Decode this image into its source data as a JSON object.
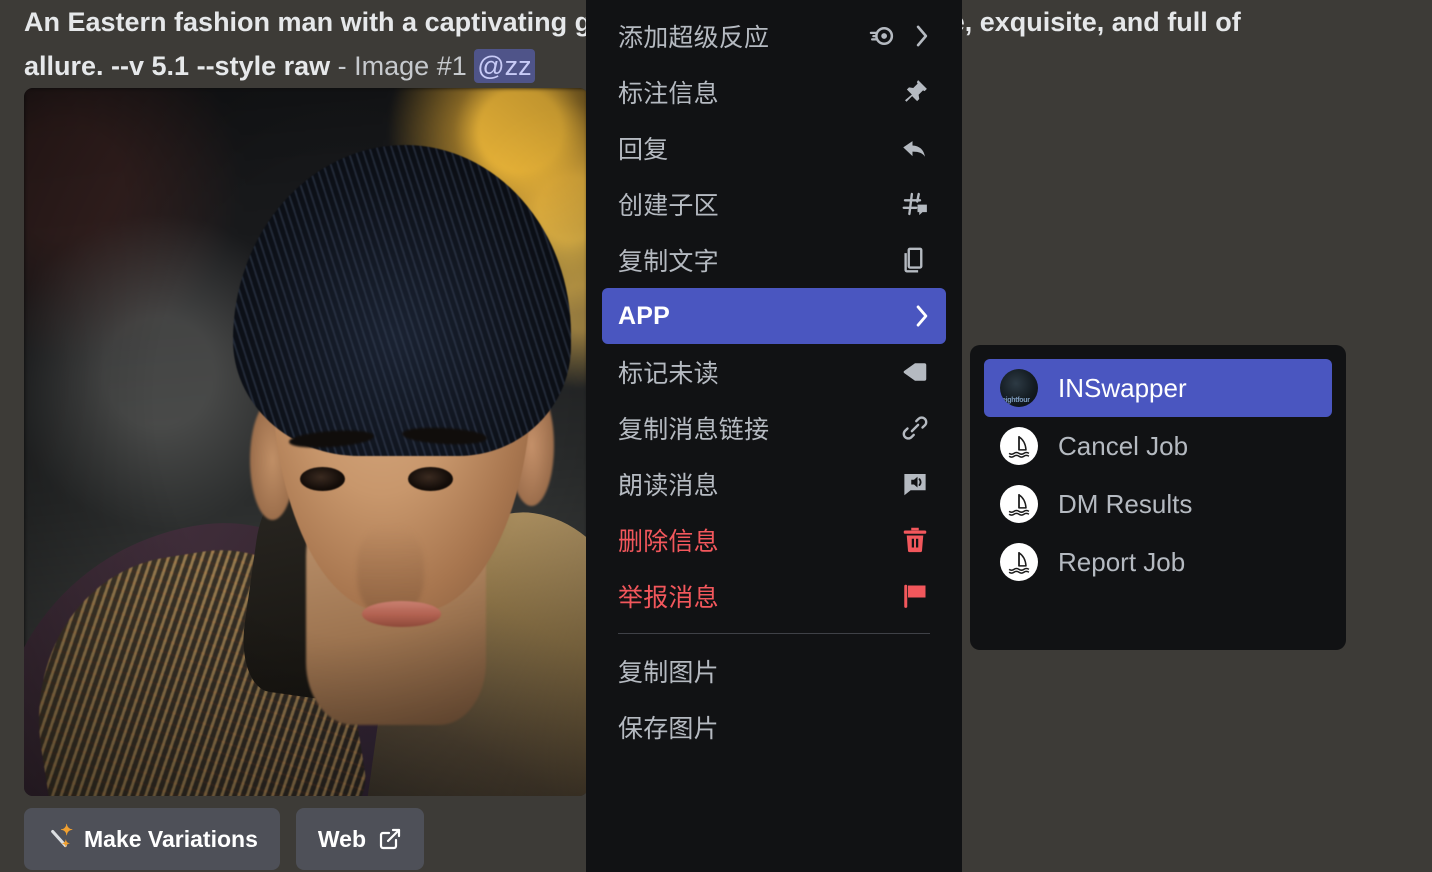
{
  "message": {
    "prompt_line1": "An Eastern fashion man with a captivating gaze, elegant, refined, delicate, exquisite, and full of",
    "prompt_line2": "allure. --v 5.1 --style raw",
    "separator": "-",
    "image_label": "Image #1",
    "mention": "@zz",
    "alt_text": "Portrait of an Eastern fashion young man with dark hair wearing an embroidered patterned jacket, blurred street bokeh background"
  },
  "actions": [
    {
      "label": "Make Variations",
      "icon": "magic-wand-icon"
    },
    {
      "label": "Web",
      "icon": "external-link-icon"
    }
  ],
  "context_menu": {
    "items": [
      {
        "label": "添加超级反应",
        "icon": "super-reaction-icon",
        "submenu_arrow": true,
        "style": "normal"
      },
      {
        "label": "标注信息",
        "icon": "pin-icon",
        "submenu_arrow": false,
        "style": "normal"
      },
      {
        "label": "回复",
        "icon": "reply-arrow-icon",
        "submenu_arrow": false,
        "style": "normal"
      },
      {
        "label": "创建子区",
        "icon": "thread-icon",
        "submenu_arrow": false,
        "style": "normal"
      },
      {
        "label": "复制文字",
        "icon": "copy-icon",
        "submenu_arrow": false,
        "style": "normal"
      },
      {
        "label": "APP",
        "icon": "none",
        "submenu_arrow": true,
        "style": "selected"
      },
      {
        "label": "标记未读",
        "icon": "mark-unread-icon",
        "submenu_arrow": false,
        "style": "normal"
      },
      {
        "label": "复制消息链接",
        "icon": "link-icon",
        "submenu_arrow": false,
        "style": "normal"
      },
      {
        "label": "朗读消息",
        "icon": "speak-message-icon",
        "submenu_arrow": false,
        "style": "normal"
      },
      {
        "label": "删除信息",
        "icon": "trash-icon",
        "submenu_arrow": false,
        "style": "danger"
      },
      {
        "label": "举报消息",
        "icon": "flag-icon",
        "submenu_arrow": false,
        "style": "danger"
      }
    ],
    "items_after_separator": [
      {
        "label": "复制图片",
        "icon": "none",
        "submenu_arrow": false,
        "style": "normal"
      },
      {
        "label": "保存图片",
        "icon": "none",
        "submenu_arrow": false,
        "style": "normal"
      }
    ]
  },
  "submenu": {
    "items": [
      {
        "label": "INSwapper",
        "avatar": "inswapper-avatar",
        "avatar_caption": "eightfour",
        "style": "selected"
      },
      {
        "label": "Cancel Job",
        "avatar": "midjourney-boat-avatar",
        "style": "normal"
      },
      {
        "label": "DM Results",
        "avatar": "midjourney-boat-avatar",
        "style": "normal"
      },
      {
        "label": "Report Job",
        "avatar": "midjourney-boat-avatar",
        "style": "normal"
      }
    ]
  },
  "colors": {
    "app_background": "#3d3b37",
    "menu_background": "#111214",
    "accent_selected": "#4a56c0",
    "text_primary": "#dbdee1",
    "text_muted": "#b5bac1",
    "danger": "#f2575c",
    "button_background": "#4e5058",
    "mention_background": "#4f5489",
    "mention_text": "#c8cbf7",
    "separator": "#3f4147"
  }
}
